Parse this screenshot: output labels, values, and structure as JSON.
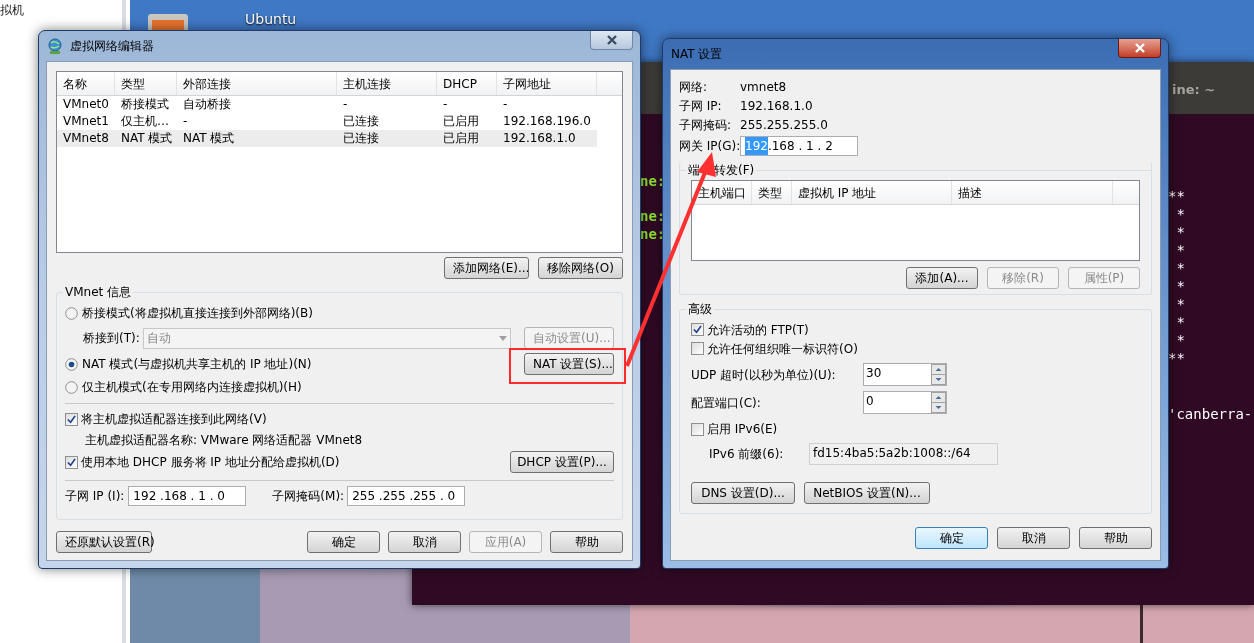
{
  "background": {
    "side_panel_text": "拟机",
    "desktop_icon_label": "Ubuntu"
  },
  "terminal": {
    "title": "ine: ~",
    "left_fragments": [
      "ne:",
      "ne:",
      "ne:"
    ],
    "right_fragments": [
      "**\n *\n *\n *\n *\n *\n *\n *\n *\n**",
      "'canberra-"
    ]
  },
  "network_editor": {
    "title": "虚拟网络编辑器",
    "table": {
      "columns": [
        "名称",
        "类型",
        "外部连接",
        "主机连接",
        "DHCP",
        "子网地址"
      ],
      "rows": [
        {
          "cells": [
            "VMnet0",
            "桥接模式",
            "自动桥接",
            "-",
            "-",
            "-"
          ],
          "selected": false
        },
        {
          "cells": [
            "VMnet1",
            "仅主机…",
            "-",
            "已连接",
            "已启用",
            "192.168.196.0"
          ],
          "selected": false
        },
        {
          "cells": [
            "VMnet8",
            "NAT 模式",
            "NAT 模式",
            "已连接",
            "已启用",
            "192.168.1.0"
          ],
          "selected": true
        }
      ]
    },
    "table_buttons": [
      {
        "label": "添加网络(E)...",
        "disabled": false
      },
      {
        "label": "移除网络(O)",
        "disabled": false
      }
    ],
    "vmnet_info": {
      "title": "VMnet 信息",
      "bridged": {
        "label": "桥接模式(将虚拟机直接连接到外部网络)(B)",
        "selected": false
      },
      "bridge_to": {
        "label": "桥接到(T):",
        "value": "自动",
        "disabled": true,
        "button": {
          "label": "自动设置(U)...",
          "disabled": true
        }
      },
      "nat": {
        "label": "NAT 模式(与虚拟机共享主机的 IP 地址)(N)",
        "selected": true,
        "button": {
          "label": "NAT 设置(S)...",
          "disabled": false
        }
      },
      "host_only": {
        "label": "仅主机模式(在专用网络内连接虚拟机)(H)",
        "selected": false
      },
      "connect_adapter": {
        "label": "将主机虚拟适配器连接到此网络(V)",
        "checked": true
      },
      "adapter_name": "主机虚拟适配器名称: VMware 网络适配器 VMnet8",
      "use_dhcp": {
        "label": "使用本地 DHCP 服务将 IP 地址分配给虚拟机(D)",
        "checked": true,
        "button": {
          "label": "DHCP 设置(P)...",
          "disabled": false
        }
      },
      "subnet_ip": {
        "label": "子网 IP (I):",
        "value": "192 .168 . 1 . 0"
      },
      "subnet_mask": {
        "label": "子网掩码(M):",
        "value": "255 .255 .255 . 0"
      }
    },
    "footer_left": {
      "label": "还原默认设置(R)",
      "disabled": false
    },
    "footer_buttons": [
      {
        "label": "确定",
        "disabled": false
      },
      {
        "label": "取消",
        "disabled": false
      },
      {
        "label": "应用(A)",
        "disabled": true
      },
      {
        "label": "帮助",
        "disabled": false
      }
    ]
  },
  "nat_settings": {
    "title": "NAT 设置",
    "info": [
      {
        "label": "网络:",
        "value": "vmnet8"
      },
      {
        "label": "子网 IP:",
        "value": "192.168.1.0"
      },
      {
        "label": "子网掩码:",
        "value": "255.255.255.0"
      }
    ],
    "gateway": {
      "label": "网关 IP(G):",
      "value_parts": [
        {
          "text": "192",
          "selected": true
        },
        {
          "text": ".168 . 1 . 2",
          "selected": false
        }
      ]
    },
    "port_forwarding": {
      "title_parts": [
        "端",
        "转发(F)"
      ],
      "columns": [
        "主机端口",
        "类型",
        "虚拟机 IP 地址",
        "描述"
      ],
      "buttons": [
        {
          "label": "添加(A)...",
          "disabled": false
        },
        {
          "label": "移除(R)",
          "disabled": true
        },
        {
          "label": "属性(P)",
          "disabled": true
        }
      ]
    },
    "advanced": {
      "title": "高级",
      "checkboxes": [
        {
          "label": "允许活动的 FTP(T)",
          "checked": true
        },
        {
          "label": "允许任何组织唯一标识符(O)",
          "checked": false
        }
      ],
      "spinners": [
        {
          "label": "UDP 超时(以秒为单位)(U):",
          "value": "30"
        },
        {
          "label": "配置端口(C):",
          "value": "0"
        }
      ],
      "ipv6": {
        "label": "启用 IPv6(E)",
        "checked": false
      },
      "ipv6_prefix": {
        "label": "IPv6 前缀(6):",
        "value": "fd15:4ba5:5a2b:1008::/64",
        "disabled": true
      },
      "buttons": [
        {
          "label": "DNS 设置(D)...",
          "disabled": false
        },
        {
          "label": "NetBIOS 设置(N)...",
          "disabled": false
        }
      ]
    },
    "footer_buttons": [
      {
        "label": "确定",
        "disabled": false,
        "default": true
      },
      {
        "label": "取消",
        "disabled": false,
        "default": false
      },
      {
        "label": "帮助",
        "disabled": false,
        "default": false
      }
    ]
  }
}
